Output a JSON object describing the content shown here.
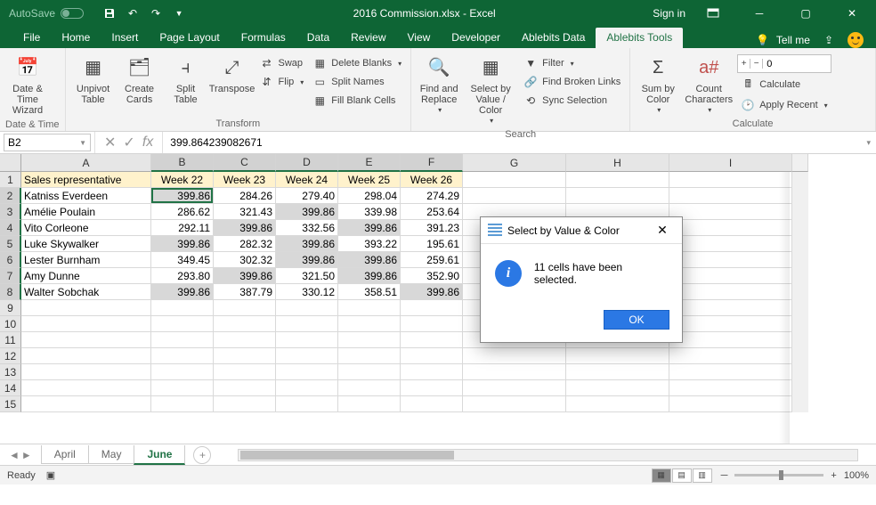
{
  "titlebar": {
    "autosave_label": "AutoSave",
    "autosave_state": "Off",
    "file_title": "2016 Commission.xlsx  -  Excel",
    "sign_in": "Sign in"
  },
  "ribbon_tabs": [
    "File",
    "Home",
    "Insert",
    "Page Layout",
    "Formulas",
    "Data",
    "Review",
    "View",
    "Developer",
    "Ablebits Data",
    "Ablebits Tools"
  ],
  "active_tab": "Ablebits Tools",
  "tell_me": "Tell me",
  "ribbon": {
    "groups": {
      "datetime": {
        "label": "Date & Time",
        "wizard": "Date & Time Wizard"
      },
      "transform": {
        "label": "Transform",
        "unpivot": "Unpivot Table",
        "create_cards": "Create Cards",
        "split_table": "Split Table",
        "transpose": "Transpose",
        "swap": "Swap",
        "flip": "Flip",
        "delete_blanks": "Delete Blanks",
        "split_names": "Split Names",
        "fill_blank": "Fill Blank Cells"
      },
      "search": {
        "label": "Search",
        "find_replace": "Find and Replace",
        "select_by": "Select by Value / Color",
        "filter": "Filter",
        "find_broken": "Find Broken Links",
        "sync_sel": "Sync Selection"
      },
      "calculate": {
        "label": "Calculate",
        "sum_color": "Sum by Color",
        "count_chars": "Count Characters",
        "stepper_value": "0",
        "calc": "Calculate",
        "apply_recent": "Apply Recent"
      }
    }
  },
  "formula_bar": {
    "name_box": "B2",
    "formula": "399.864239082671"
  },
  "columns": [
    "A",
    "B",
    "C",
    "D",
    "E",
    "F",
    "G",
    "H",
    "I"
  ],
  "row_numbers": [
    1,
    2,
    3,
    4,
    5,
    6,
    7,
    8,
    9,
    10,
    11,
    12,
    13,
    14,
    15
  ],
  "headers": [
    "Sales representative",
    "Week 22",
    "Week 23",
    "Week 24",
    "Week 25",
    "Week 26"
  ],
  "data_rows": [
    {
      "name": "Katniss Everdeen",
      "vals": [
        "399.86",
        "284.26",
        "279.40",
        "298.04",
        "274.29"
      ],
      "hl": [
        true,
        false,
        false,
        false,
        false
      ]
    },
    {
      "name": "Amélie Poulain",
      "vals": [
        "286.62",
        "321.43",
        "399.86",
        "339.98",
        "253.64"
      ],
      "hl": [
        false,
        false,
        true,
        false,
        false
      ]
    },
    {
      "name": "Vito Corleone",
      "vals": [
        "292.11",
        "399.86",
        "332.56",
        "399.86",
        "391.23"
      ],
      "hl": [
        false,
        true,
        false,
        true,
        false
      ]
    },
    {
      "name": "Luke Skywalker",
      "vals": [
        "399.86",
        "282.32",
        "399.86",
        "393.22",
        "195.61"
      ],
      "hl": [
        true,
        false,
        true,
        false,
        false
      ]
    },
    {
      "name": "Lester Burnham",
      "vals": [
        "349.45",
        "302.32",
        "399.86",
        "399.86",
        "259.61"
      ],
      "hl": [
        false,
        false,
        true,
        true,
        false
      ]
    },
    {
      "name": "Amy Dunne",
      "vals": [
        "293.80",
        "399.86",
        "321.50",
        "399.86",
        "352.90"
      ],
      "hl": [
        false,
        true,
        false,
        true,
        false
      ]
    },
    {
      "name": "Walter Sobchak",
      "vals": [
        "399.86",
        "387.79",
        "330.12",
        "358.51",
        "399.86"
      ],
      "hl": [
        true,
        false,
        false,
        false,
        true
      ]
    }
  ],
  "sheet_tabs": [
    "April",
    "May",
    "June"
  ],
  "active_sheet": "June",
  "statusbar": {
    "status": "Ready",
    "zoom": "100%"
  },
  "dialog": {
    "title": "Select by Value & Color",
    "message": "11 cells have been selected.",
    "ok": "OK"
  }
}
